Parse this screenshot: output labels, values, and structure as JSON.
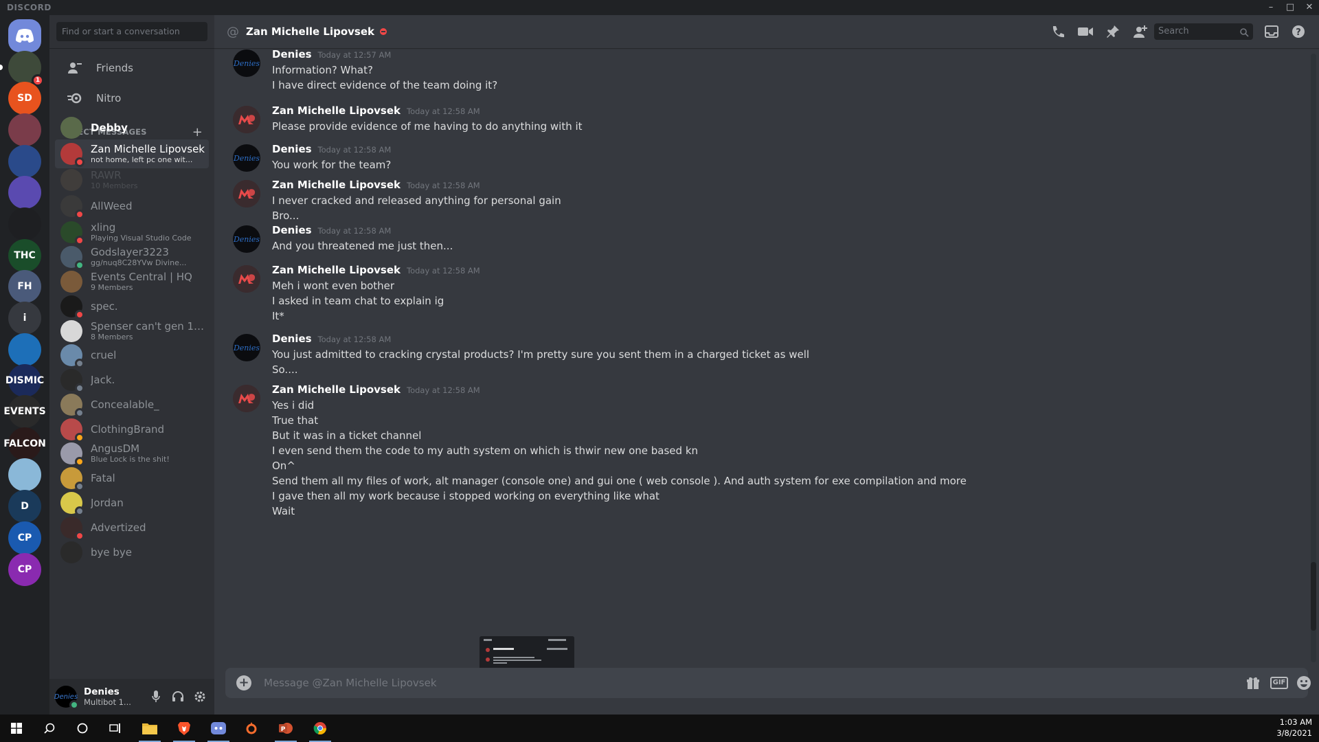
{
  "window": {
    "brand": "DISCORD"
  },
  "guilds": [
    {
      "name": "home",
      "label": "",
      "color": "#7289da"
    },
    {
      "name": "server-1",
      "label": "",
      "color": "#3e4a3a",
      "badge": "1"
    },
    {
      "name": "server-sd",
      "label": "SD",
      "color": "#e8531e"
    },
    {
      "name": "server-3",
      "label": "",
      "color": "#7a3c4a"
    },
    {
      "name": "server-4",
      "label": "",
      "color": "#2a4a8a"
    },
    {
      "name": "server-5",
      "label": "",
      "color": "#5a4ab0"
    },
    {
      "name": "server-6",
      "label": "",
      "color": "#1e1f22"
    },
    {
      "name": "server-thc",
      "label": "THC",
      "color": "#1a4d2a"
    },
    {
      "name": "server-factions",
      "label": "FH",
      "color": "#4a5a7a"
    },
    {
      "name": "server-i",
      "label": "i",
      "color": "#36393f"
    },
    {
      "name": "server-10",
      "label": "",
      "color": "#1d6fb8"
    },
    {
      "name": "server-dismic",
      "label": "DISMIC",
      "color": "#1b2a5a"
    },
    {
      "name": "server-events",
      "label": "EVENTS",
      "color": "#2a2a2a"
    },
    {
      "name": "server-falcon",
      "label": "FALCON",
      "color": "#2a1a1a"
    },
    {
      "name": "server-14",
      "label": "",
      "color": "#8ab8d8"
    },
    {
      "name": "server-d",
      "label": "D",
      "color": "#1a3a5a"
    },
    {
      "name": "server-cp1",
      "label": "CP",
      "color": "#1a5ab0"
    },
    {
      "name": "server-cp2",
      "label": "CP",
      "color": "#8a2ab0"
    }
  ],
  "sidebar": {
    "search_placeholder": "Find or start a conversation",
    "friends": "Friends",
    "nitro": "Nitro",
    "dm_header": "DIRECT MESSAGES",
    "dms": [
      {
        "name": "Debby",
        "sub": "",
        "status": "",
        "style": "bold",
        "avatar": "#5a6a4a"
      },
      {
        "name": "Zan Michelle Lipovsek",
        "sub": "not home, left pc one wit...",
        "status": "#f04747",
        "style": "active",
        "avatar": "#b33a3a"
      },
      {
        "name": "RAWR",
        "sub": "10 Members",
        "status": "",
        "style": "faded",
        "avatar": "#6a5a4a"
      },
      {
        "name": "AllWeed",
        "sub": "",
        "status": "#f04747",
        "style": "",
        "avatar": "#3a3a3a"
      },
      {
        "name": "xling",
        "sub": "Playing Visual Studio Code",
        "status": "#f04747",
        "style": "",
        "avatar": "#2a4a2a"
      },
      {
        "name": "Godslayer3223",
        "sub": "gg/nuq8C28YVw Divine...",
        "status": "#43b581",
        "style": "",
        "avatar": "#4a5a6a"
      },
      {
        "name": "Events Central | HQ",
        "sub": "9 Members",
        "status": "",
        "style": "",
        "avatar": "#7a5a3a"
      },
      {
        "name": "spec.",
        "sub": "",
        "status": "#f04747",
        "style": "",
        "avatar": "#1a1a1a"
      },
      {
        "name": "Spenser can't gen 1.1...",
        "sub": "8 Members",
        "status": "",
        "style": "",
        "avatar": "#d8d8d8"
      },
      {
        "name": "cruel",
        "sub": "",
        "status": "#747f8d",
        "style": "",
        "avatar": "#6a8aaa"
      },
      {
        "name": "Jack.",
        "sub": "",
        "status": "#747f8d",
        "style": "",
        "avatar": "#2a2a2a"
      },
      {
        "name": "Concealable_",
        "sub": "",
        "status": "#747f8d",
        "style": "",
        "avatar": "#8a7a5a"
      },
      {
        "name": "ClothingBrand",
        "sub": "",
        "status": "#faa61a",
        "style": "",
        "avatar": "#b84a4a"
      },
      {
        "name": "AngusDM",
        "sub": "Blue Lock is the shit!",
        "status": "#faa61a",
        "style": "",
        "avatar": "#9a9aaa"
      },
      {
        "name": "Fatal",
        "sub": "",
        "status": "#747f8d",
        "style": "",
        "avatar": "#c89a3a"
      },
      {
        "name": "Jordan",
        "sub": "",
        "status": "#747f8d",
        "style": "",
        "avatar": "#d8c84a"
      },
      {
        "name": "Advertized",
        "sub": "",
        "status": "#f04747",
        "style": "",
        "avatar": "#3a2a2a"
      },
      {
        "name": "bye bye",
        "sub": "",
        "status": "",
        "style": "",
        "avatar": "#2a2a2a"
      }
    ]
  },
  "user": {
    "name": "Denies",
    "sub": "Multibot 1...",
    "avatar_text": "Denies"
  },
  "chat": {
    "title": "Zan Michelle Lipovsek",
    "search": "Search",
    "composer_placeholder": "Message @Zan Michelle Lipovsek",
    "gif": "GIF",
    "messages": [
      {
        "author": "Denies",
        "time": "Today at 12:57 AM",
        "av": "denies",
        "lines": [
          "Information? What?",
          "I have direct evidence of the team doing it?"
        ]
      },
      {
        "author": "Zan Michelle Lipovsek",
        "time": "Today at 12:58 AM",
        "av": "zan",
        "lines": [
          "Please provide evidence of me having to do anything with it"
        ]
      },
      {
        "author": "Denies",
        "time": "Today at 12:58 AM",
        "av": "denies",
        "lines": [
          "You work for the team?"
        ]
      },
      {
        "author": "Zan Michelle Lipovsek",
        "time": "Today at 12:58 AM",
        "av": "zan",
        "lines": [
          "I never cracked and released anything for personal gain",
          "Bro..."
        ]
      },
      {
        "author": "Denies",
        "time": "Today at 12:58 AM",
        "av": "denies",
        "lines": [
          "And you threatened me just then..."
        ]
      },
      {
        "author": "Zan Michelle Lipovsek",
        "time": "Today at 12:58 AM",
        "av": "zan",
        "lines": [
          "Meh i wont even bother",
          "I asked in team chat to explain ig",
          "It*"
        ]
      },
      {
        "author": "Denies",
        "time": "Today at 12:58 AM",
        "av": "denies",
        "lines": [
          "You just admitted to cracking crystal products? I'm pretty sure you sent them in a charged ticket as well",
          "So...."
        ]
      },
      {
        "author": "Zan Michelle Lipovsek",
        "time": "Today at 12:58 AM",
        "av": "zan",
        "lines": [
          "Yes i did",
          "True that",
          "But it was in a ticket channel",
          "I even send them the code to my auth system on which is thwir new one based kn",
          "On^",
          "Send them all my files of work, alt manager (console one) and gui one ( web console ). And auth system for exe compilation and more",
          "I gave then all my work because i stopped working on everything like what",
          "Wait"
        ]
      }
    ]
  },
  "taskbar": {
    "time": "1:03 AM",
    "date": "3/8/2021"
  },
  "colors": {
    "accent": "#7289da",
    "dnd": "#f04747",
    "online": "#43b581",
    "idle": "#faa61a"
  }
}
